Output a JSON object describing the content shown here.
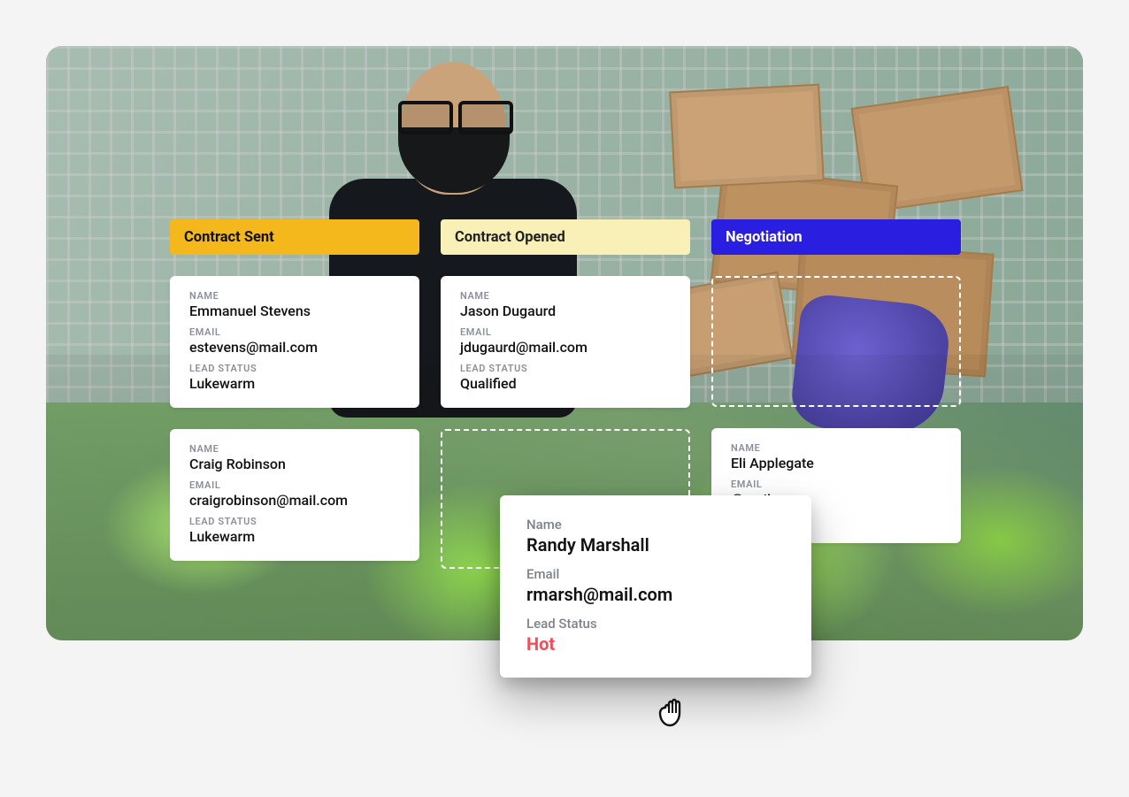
{
  "labels": {
    "name": "NAME",
    "email": "EMAIL",
    "lead_status": "LEAD STATUS"
  },
  "drag_labels": {
    "name": "Name",
    "email": "Email",
    "lead_status": "Lead Status"
  },
  "columns": [
    {
      "title": "Contract Sent",
      "cards": [
        {
          "name": "Emmanuel Stevens",
          "email": "estevens@mail.com",
          "lead_status": "Lukewarm"
        },
        {
          "name": "Craig Robinson",
          "email": "craigrobinson@mail.com",
          "lead_status": "Lukewarm"
        }
      ]
    },
    {
      "title": "Contract Opened",
      "cards": [
        {
          "name": "Jason Dugaurd",
          "email": "jdugaurd@mail.com",
          "lead_status": "Qualified"
        }
      ]
    },
    {
      "title": "Negotiation",
      "cards": [
        {
          "name": "Eli Applegate",
          "email": "@mail.com",
          "lead_status": ""
        }
      ]
    }
  ],
  "dragging": {
    "name": "Randy Marshall",
    "email": "rmarsh@mail.com",
    "lead_status": "Hot"
  }
}
